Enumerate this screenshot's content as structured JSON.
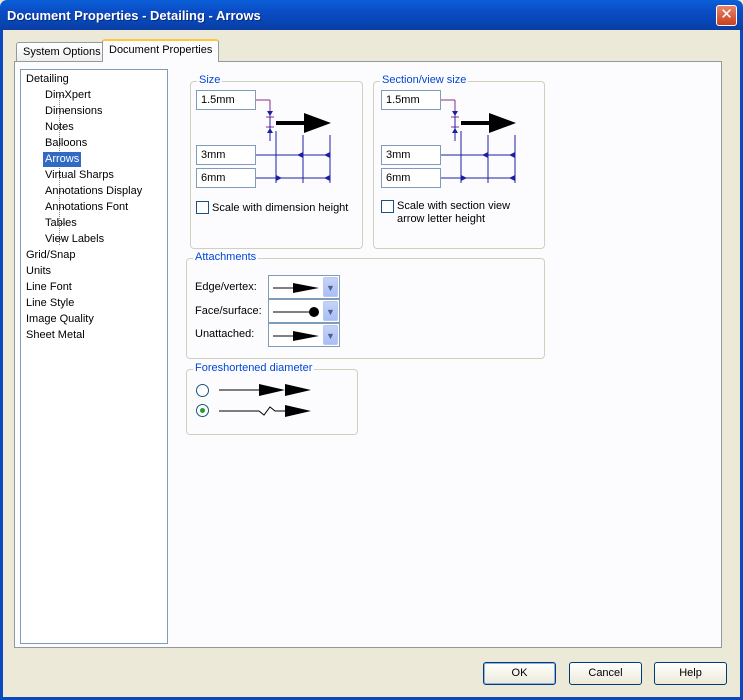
{
  "window": {
    "title": "Document Properties - Detailing - Arrows",
    "close_glyph": "✕"
  },
  "tabs": [
    {
      "label": "System Options",
      "active": false
    },
    {
      "label": "Document Properties",
      "active": true
    }
  ],
  "tree": {
    "items": [
      {
        "label": "Detailing",
        "selected": false
      },
      {
        "label": "DimXpert",
        "selected": false
      },
      {
        "label": "Dimensions",
        "selected": false
      },
      {
        "label": "Notes",
        "selected": false
      },
      {
        "label": "Balloons",
        "selected": false
      },
      {
        "label": "Arrows",
        "selected": true
      },
      {
        "label": "Virtual Sharps",
        "selected": false
      },
      {
        "label": "Annotations Display",
        "selected": false
      },
      {
        "label": "Annotations Font",
        "selected": false
      },
      {
        "label": "Tables",
        "selected": false
      },
      {
        "label": "View Labels",
        "selected": false
      },
      {
        "label": "Grid/Snap",
        "selected": false
      },
      {
        "label": "Units",
        "selected": false
      },
      {
        "label": "Line Font",
        "selected": false
      },
      {
        "label": "Line Style",
        "selected": false
      },
      {
        "label": "Image Quality",
        "selected": false
      },
      {
        "label": "Sheet Metal",
        "selected": false
      }
    ]
  },
  "size": {
    "legend": "Size",
    "height": "1.5mm",
    "width": "3mm",
    "length": "6mm",
    "scale_label": "Scale with dimension height",
    "scale_checked": false
  },
  "section_size": {
    "legend": "Section/view size",
    "height": "1.5mm",
    "width": "3mm",
    "length": "6mm",
    "scale_label_line1": "Scale with section view",
    "scale_label_line2": "arrow letter height",
    "scale_checked": false
  },
  "attachments": {
    "legend": "Attachments",
    "edge_label": "Edge/vertex:",
    "face_label": "Face/surface:",
    "unattached_label": "Unattached:",
    "edge_style": "arrow-filled",
    "face_style": "dot",
    "unattached_style": "arrow-filled"
  },
  "foreshortened": {
    "legend": "Foreshortened diameter",
    "selected_option": 2
  },
  "buttons": {
    "ok": "OK",
    "cancel": "Cancel",
    "help": "Help"
  },
  "colors": {
    "title_bar": "#0a4bc4",
    "legend_text": "#0046d5",
    "selection": "#316ac5",
    "dimension_lines": "#1b1fa0",
    "extension_lines": "#8a2b8a"
  }
}
